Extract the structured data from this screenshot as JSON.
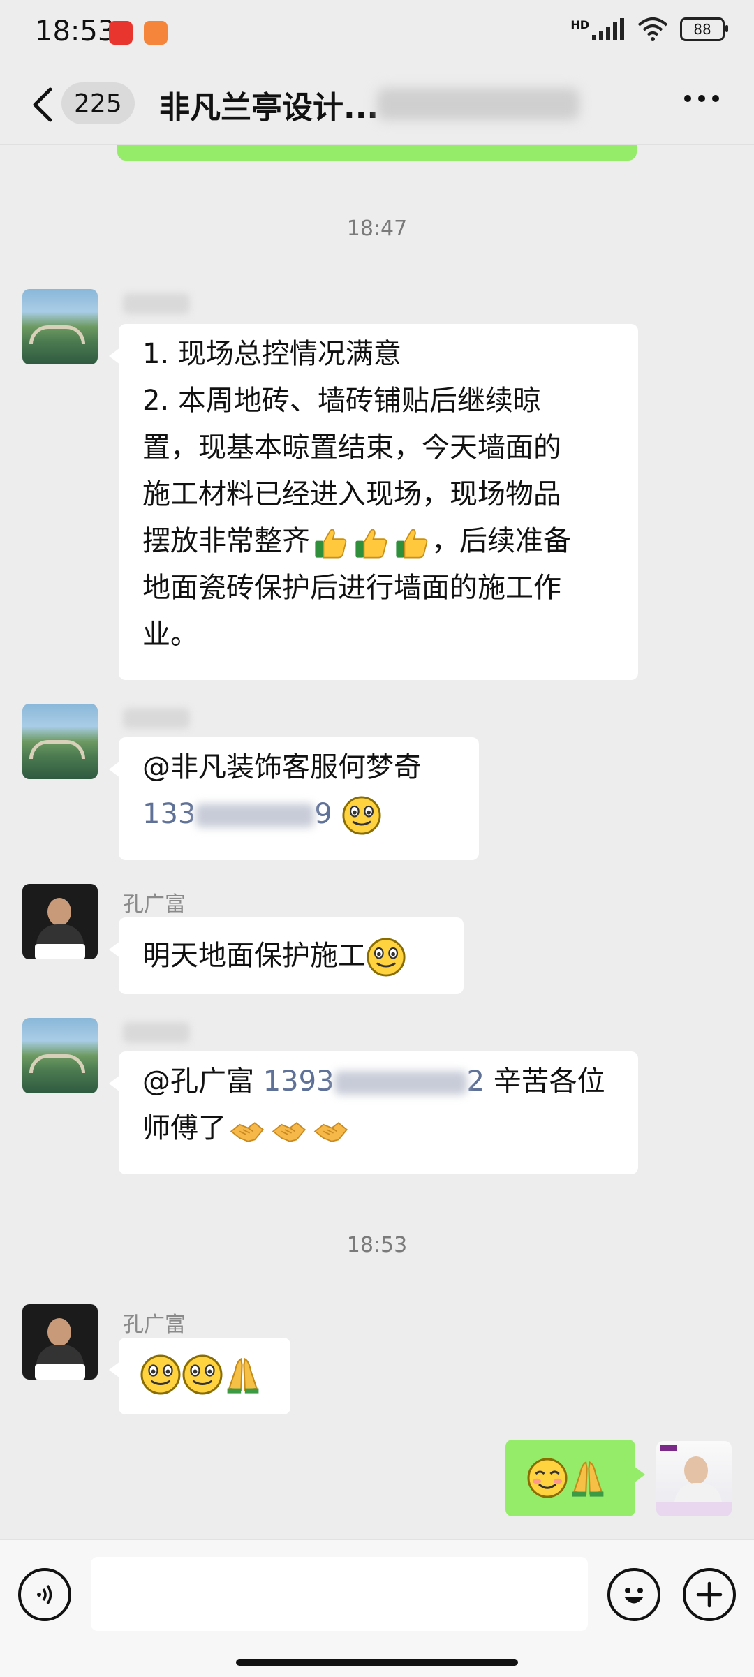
{
  "status_bar": {
    "time": "18:53",
    "network": "HD",
    "battery": "88"
  },
  "header": {
    "unread_count": "225",
    "title": "非凡兰亭设计..."
  },
  "timestamps": [
    "18:47",
    "18:53"
  ],
  "messages": {
    "m1": {
      "lines": [
        "1. 现场总控情况满意",
        "2. 本周地砖、墙砖铺贴后继续晾",
        "置，现基本晾置结束，今天墙面的",
        "施工材料已经进入现场，现场物品",
        "摆放非常整齐",
        "，后续准备",
        "地面瓷砖保护后进行墙面的施工作",
        "业。"
      ]
    },
    "m2": {
      "mention": "@非凡装饰客服何梦奇",
      "phone_start": "133",
      "phone_end": "9"
    },
    "m3": {
      "sender": "孔广富",
      "text": "明天地面保护施工"
    },
    "m4": {
      "mention": "@孔广富",
      "phone_start": "1393",
      "phone_end": "2",
      "text_after": "辛苦各位",
      "line2": "师傅了"
    },
    "m5": {
      "sender": "孔广富"
    }
  },
  "input": {
    "placeholder": ""
  },
  "icons": {
    "voice": "voice-icon",
    "emoji": "emoji-icon",
    "plus": "plus-icon",
    "thumbs_up": "thumbs-up-emoji",
    "handshake": "handshake-emoji",
    "smile": "smile-emoji",
    "pray": "pray-emoji",
    "blush": "blush-emoji"
  },
  "colors": {
    "background": "#EDEDED",
    "self_bubble": "#95EC69",
    "other_bubble": "#FFFFFF",
    "phone_link": "#5F7197"
  }
}
